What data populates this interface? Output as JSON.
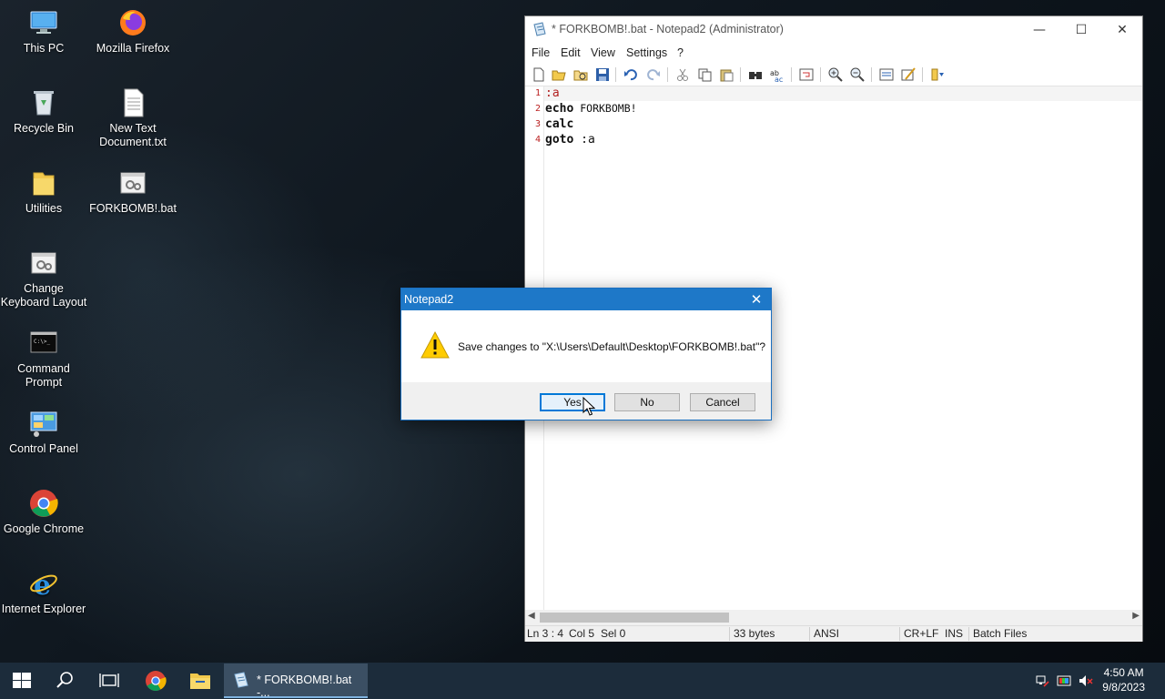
{
  "desktop": {
    "icons": [
      {
        "label": "This PC",
        "icon": "this-pc-icon"
      },
      {
        "label": "Mozilla Firefox",
        "icon": "firefox-icon"
      },
      {
        "label": "Recycle Bin",
        "icon": "recycle-bin-icon"
      },
      {
        "label": "New Text Document.txt",
        "icon": "text-document-icon"
      },
      {
        "label": "Utilities",
        "icon": "folder-icon"
      },
      {
        "label": "FORKBOMB!.bat",
        "icon": "batch-file-icon"
      },
      {
        "label": "Change Keyboard Layout",
        "icon": "batch-file-icon"
      },
      {
        "label": "Command Prompt",
        "icon": "command-prompt-icon"
      },
      {
        "label": "Control Panel",
        "icon": "control-panel-icon"
      },
      {
        "label": "Google Chrome",
        "icon": "chrome-icon"
      },
      {
        "label": "Internet Explorer",
        "icon": "internet-explorer-icon"
      }
    ]
  },
  "notepad": {
    "title": "* FORKBOMB!.bat - Notepad2 (Administrator)",
    "controls": {
      "minimize": "—",
      "maximize": "☐",
      "close": "✕"
    },
    "menu": [
      "File",
      "Edit",
      "View",
      "Settings",
      "?"
    ],
    "lines": [
      {
        "num": "1",
        "text": ":a"
      },
      {
        "num": "2",
        "keyword": "echo",
        "rest": " FORKBOMB!"
      },
      {
        "num": "3",
        "keyword": "calc",
        "rest": ""
      },
      {
        "num": "4",
        "keyword": "goto",
        "rest": " :a"
      }
    ],
    "status": {
      "position": "Ln 3 : 4",
      "col": "Col 5",
      "sel": "Sel 0",
      "size": "33 bytes",
      "encoding": "ANSI",
      "eol": "CR+LF",
      "mode": "INS",
      "lexer": "Batch Files"
    }
  },
  "dialog": {
    "title": "Notepad2",
    "close": "✕",
    "message": "Save changes to \"X:\\Users\\Default\\Desktop\\FORKBOMB!.bat\"?",
    "buttons": {
      "yes": "Yes",
      "no": "No",
      "cancel": "Cancel"
    }
  },
  "taskbar": {
    "notepad_task": "* FORKBOMB!.bat -...",
    "time": "4:50 AM",
    "date": "9/8/2023"
  },
  "colors": {
    "accent": "#1e78c8",
    "line_number": "#b22222"
  }
}
